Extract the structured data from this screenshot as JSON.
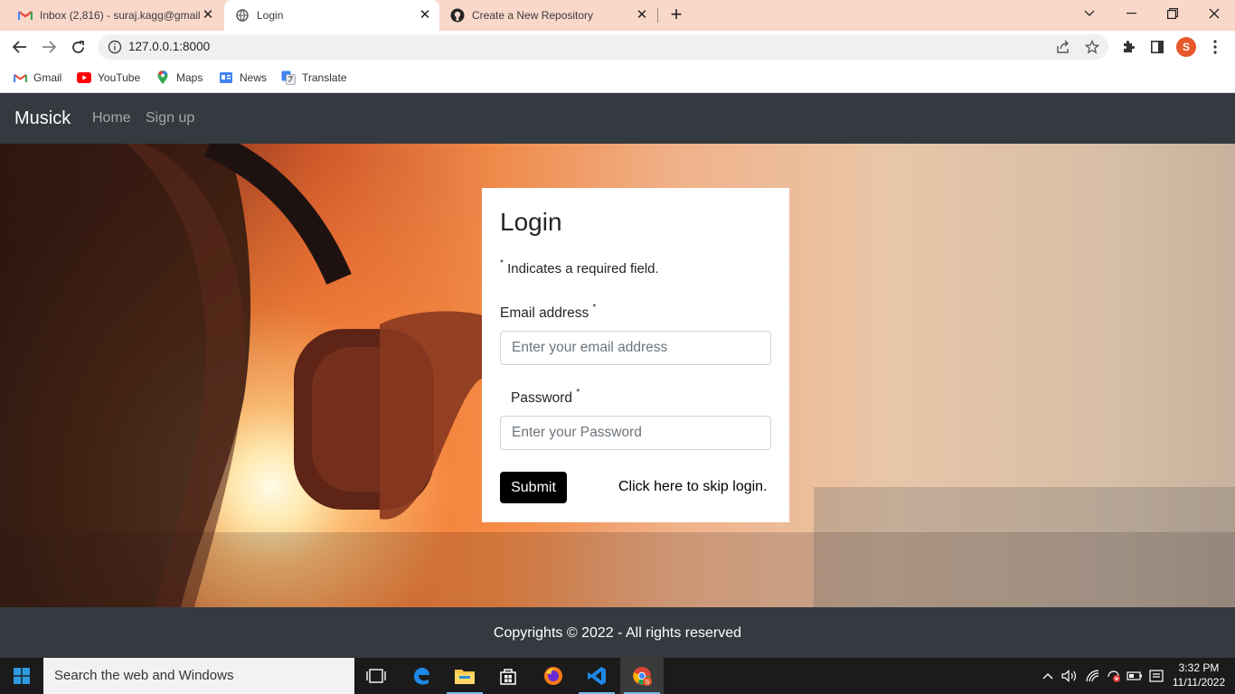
{
  "browser": {
    "tabs": [
      {
        "title": "Inbox (2,816) - suraj.kagg@gmail",
        "icon": "gmail-icon"
      },
      {
        "title": "Login",
        "icon": "globe-icon"
      },
      {
        "title": "Create a New Repository",
        "icon": "github-icon"
      }
    ],
    "url": "127.0.0.1:8000",
    "profile_initial": "S",
    "bookmarks": [
      "Gmail",
      "YouTube",
      "Maps",
      "News",
      "Translate"
    ]
  },
  "site": {
    "brand": "Musick",
    "nav": [
      "Home",
      "Sign up"
    ]
  },
  "login": {
    "title": "Login",
    "required_mark": "*",
    "required_note": "Indicates a required field.",
    "email_label": "Email address",
    "email_placeholder": "Enter your email address",
    "password_label": "Password",
    "password_placeholder": "Enter your Password",
    "submit_label": "Submit",
    "skip_text": "Click here to skip login."
  },
  "footer": {
    "copyright": "Copyrights © 2022 - All rights reserved"
  },
  "taskbar": {
    "search_placeholder": "Search the web and Windows",
    "time": "3:32 PM",
    "date": "11/11/2022"
  },
  "colors": {
    "tabstrip": "#f9d8c9",
    "navbar": "#343a40",
    "button": "#000000"
  }
}
